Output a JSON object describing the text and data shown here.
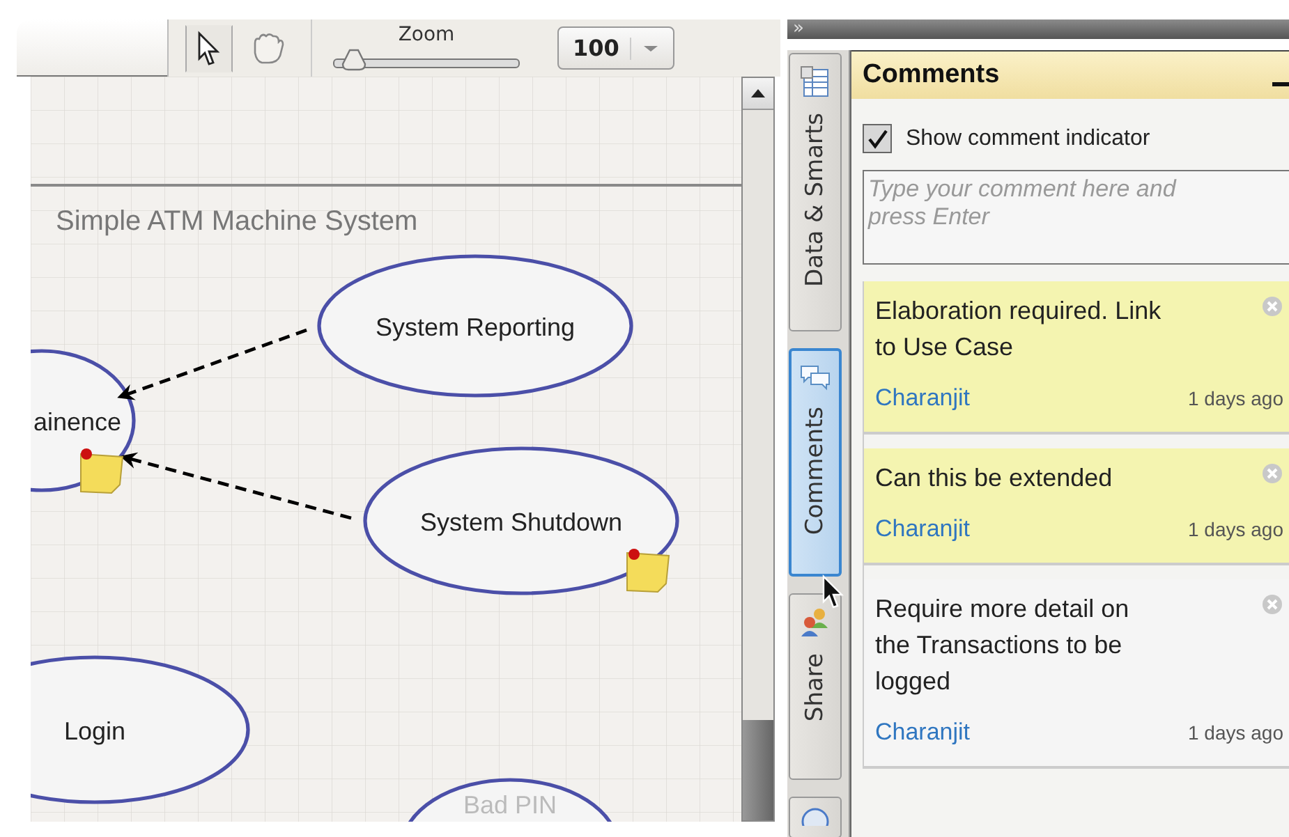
{
  "toolbar": {
    "tools": [
      {
        "kind": "pointer",
        "selected": true
      },
      {
        "kind": "hand",
        "selected": false
      }
    ],
    "zoom": {
      "label": "Zoom",
      "level": 0.14
    },
    "zoom_value": "100"
  },
  "diagram": {
    "title": "Simple ATM Machine System",
    "nodes": [
      {
        "label": "ainence",
        "note": true
      },
      {
        "label": "System Reporting",
        "note": false
      },
      {
        "label": "System Shutdown",
        "note": true
      },
      {
        "label": "Login",
        "note": false
      },
      {
        "label": "Bad PIN",
        "note": false
      }
    ]
  },
  "collapse_glyph": "»",
  "side_tabs": [
    {
      "label": "Data & Smarts",
      "kind": "data",
      "selected": false
    },
    {
      "label": "Comments",
      "kind": "comments",
      "selected": true
    },
    {
      "label": "Share",
      "kind": "share",
      "selected": false
    },
    {
      "kind": "help",
      "selected": false
    }
  ],
  "panel": {
    "title": "Comments",
    "show_indicator": {
      "label": "Show comment indicator",
      "checked": true
    },
    "input": {
      "placeholder": "Type your comment here and press Enter"
    },
    "comments": [
      {
        "text": "Elaboration required. Link to Use Case",
        "author": "Charanjit",
        "time": "1 days ago",
        "highlighted": true
      },
      {
        "text": "Can this be extended",
        "author": "Charanjit",
        "time": "1 days ago",
        "highlighted": true
      },
      {
        "text": "Require more detail on the Transactions to be logged",
        "author": "Charanjit",
        "time": "1 days ago",
        "highlighted": false
      }
    ]
  }
}
